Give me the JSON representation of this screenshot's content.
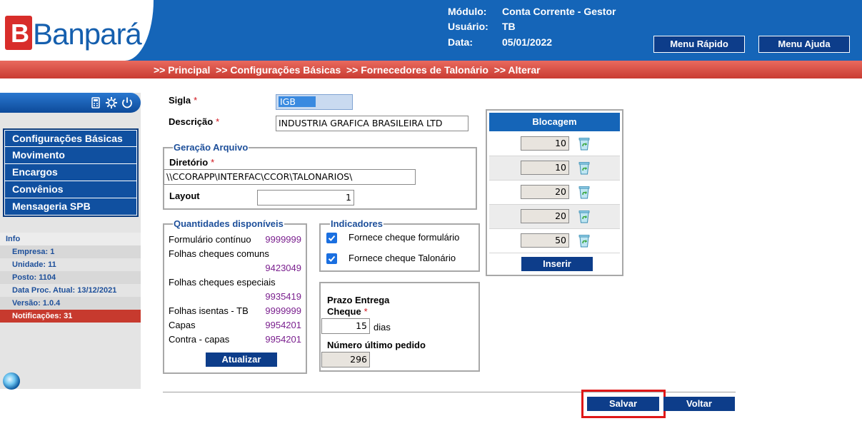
{
  "header": {
    "logo_text": "Banpará",
    "modulo_label": "Módulo:",
    "modulo_value": "Conta Corrente - Gestor",
    "usuario_label": "Usuário:",
    "usuario_value": "TB",
    "data_label": "Data:",
    "data_value": "05/01/2022",
    "menu_rapido": "Menu Rápido",
    "menu_ajuda": "Menu Ajuda"
  },
  "breadcrumb": ">> Principal  >> Configurações Básicas  >> Fornecedores de Talonário  >> Alterar",
  "sidebar": {
    "menu": [
      {
        "label": "Configurações Básicas"
      },
      {
        "label": "Movimento"
      },
      {
        "label": "Encargos"
      },
      {
        "label": "Convênios"
      },
      {
        "label": "Mensageria SPB"
      }
    ],
    "info_title": "Info",
    "info": [
      "Empresa: 1",
      "Unidade: 11",
      "Posto: 1104",
      "Data Proc. Atual: 13/12/2021",
      "Versão: 1.0.4",
      "Notificações: 31"
    ]
  },
  "form": {
    "sigla_label": "Sigla",
    "sigla_value": "IGB",
    "descricao_label": "Descrição",
    "descricao_value": "INDUSTRIA GRAFICA BRASILEIRA LTD",
    "required_mark": "*",
    "geracao_title": "Geração Arquivo",
    "diretorio_label": "Diretório",
    "diretorio_value": "\\\\CCORAPP\\INTERFAC\\CCOR\\TALONARIOS\\",
    "layout_label": "Layout",
    "layout_value": "1"
  },
  "quantidades": {
    "title": "Quantidades disponíveis",
    "rows": [
      {
        "label": "Formulário contínuo",
        "value": "9999999"
      },
      {
        "label": "Folhas cheques comuns",
        "value": "9423049"
      },
      {
        "label": "Folhas cheques especiais",
        "value": "9935419"
      },
      {
        "label": "Folhas isentas - TB",
        "value": "9999999"
      },
      {
        "label": "Capas",
        "value": "9954201"
      },
      {
        "label": "Contra - capas",
        "value": "9954201"
      }
    ],
    "atualizar": "Atualizar"
  },
  "indicadores": {
    "title": "Indicadores",
    "items": [
      {
        "label": "Fornece cheque formulário",
        "checked": true
      },
      {
        "label": "Fornece cheque Talonário",
        "checked": true
      }
    ]
  },
  "prazo": {
    "label_line1": "Prazo Entrega",
    "label_line2": "Cheque",
    "value": "15",
    "unit": "dias",
    "ultimo_label": "Número último pedido",
    "ultimo_value": "296"
  },
  "blocagem": {
    "title": "Blocagem",
    "values": [
      "10",
      "10",
      "20",
      "20",
      "50"
    ],
    "inserir": "Inserir"
  },
  "actions": {
    "salvar": "Salvar",
    "voltar": "Voltar"
  },
  "colors": {
    "header_blue": "#1565b8",
    "button_navy": "#0d3d8a",
    "breadcrumb_red": "#d84a3f",
    "value_purple": "#7a1f8e",
    "highlight_red": "#e01818"
  }
}
